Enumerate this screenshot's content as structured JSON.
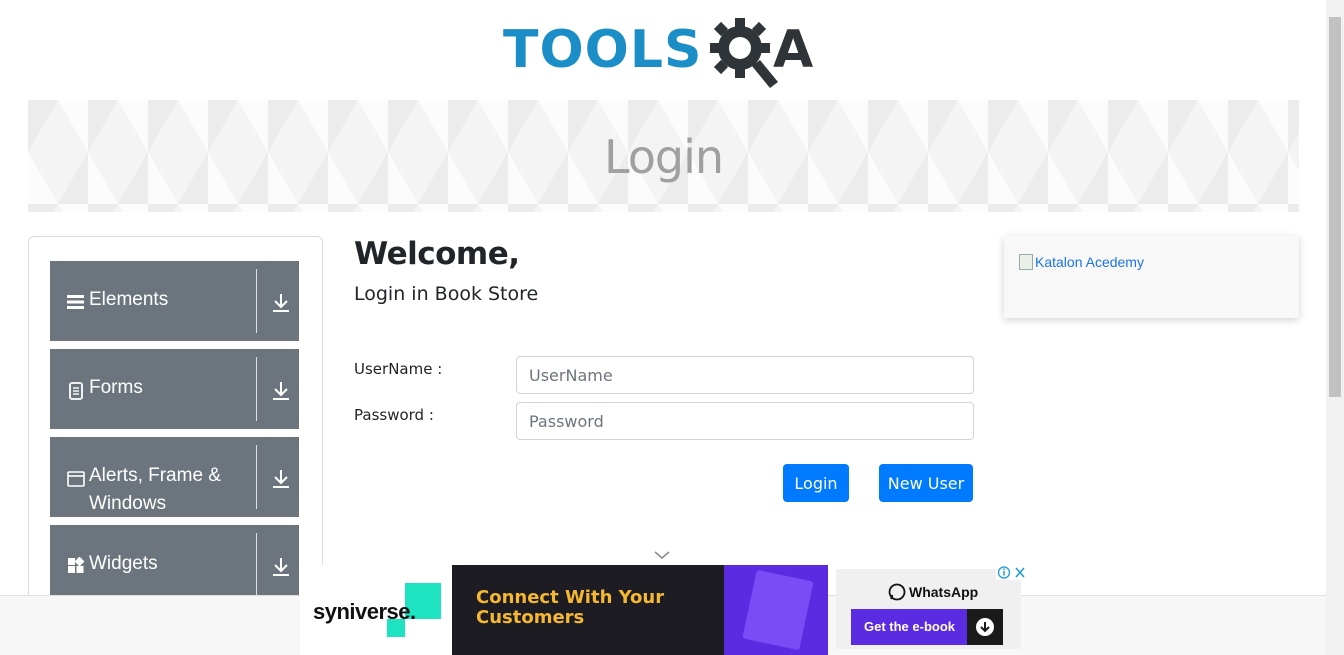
{
  "header": {
    "logo_tools": "TOOLS",
    "logo_a": "A"
  },
  "banner": {
    "title": "Login"
  },
  "sidebar": {
    "groups": [
      {
        "label": "Elements",
        "icon": "menu-icon"
      },
      {
        "label": "Forms",
        "icon": "form-icon"
      },
      {
        "label": "Alerts, Frame & Windows",
        "icon": "window-icon"
      },
      {
        "label": "Widgets",
        "icon": "widgets-icon"
      }
    ]
  },
  "main": {
    "welcome": "Welcome,",
    "subtitle": "Login in Book Store",
    "username_label": "UserName :",
    "username_placeholder": "UserName",
    "password_label": "Password :",
    "password_placeholder": "Password",
    "login_button": "Login",
    "new_user_button": "New User"
  },
  "right_ad": {
    "alt_text": "Katalon Acedemy"
  },
  "bottom_ad": {
    "brand": "syniverse.",
    "headline": "Connect With Your Customers",
    "app": "WhatsApp",
    "cta": "Get the e-book"
  },
  "colors": {
    "accent": "#007bff",
    "nav_bg": "#6c757d",
    "logo_blue": "#1b8ec8"
  }
}
